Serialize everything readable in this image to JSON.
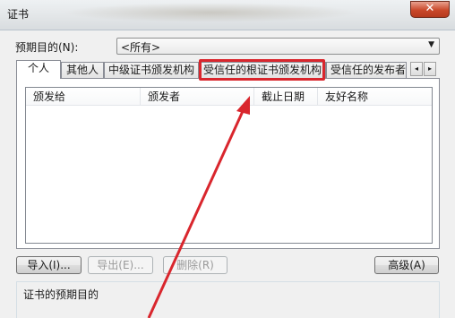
{
  "window": {
    "title": "证书",
    "close_glyph": "✕"
  },
  "purpose": {
    "label": "预期目的(N):",
    "value": "<所有>"
  },
  "tabs": [
    {
      "label": "个人",
      "active": true
    },
    {
      "label": "其他人",
      "active": false
    },
    {
      "label": "中级证书颁发机构",
      "active": false
    },
    {
      "label": "受信任的根证书颁发机构",
      "active": false,
      "highlighted": true
    },
    {
      "label": "受信任的发布者",
      "active": false
    }
  ],
  "tab_scroll": {
    "left": "◂",
    "right": "▸"
  },
  "columns": [
    "颁发给",
    "颁发者",
    "截止日期",
    "友好名称"
  ],
  "buttons": {
    "import": "导入(I)...",
    "export": "导出(E)...",
    "remove": "删除(R)",
    "advanced": "高级(A)"
  },
  "purpose_group": {
    "label": "证书的预期目的"
  },
  "colors": {
    "highlight": "#d9262d"
  }
}
